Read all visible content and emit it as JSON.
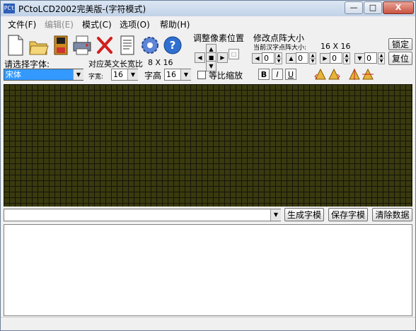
{
  "window": {
    "app_icon_text": "PCt",
    "title": "PCtoLCD2002完美版-(字符模式)",
    "controls": {
      "minimize": "—",
      "maximize": "□",
      "close": "X"
    }
  },
  "menu": [
    {
      "label": "文件(F)"
    },
    {
      "label": "编辑(E)"
    },
    {
      "label": "模式(C)"
    },
    {
      "label": "选项(O)"
    },
    {
      "label": "帮助(H)"
    }
  ],
  "toolbar": {
    "icons": [
      "new-icon",
      "open-icon",
      "save-icon",
      "print-icon",
      "delete-icon",
      "document-icon",
      "settings-gear-icon",
      "help-icon"
    ]
  },
  "font_panel": {
    "select_font_label": "请选择字体:",
    "font_value": "宋体",
    "english_width_label": "对应英文长宽比",
    "english_width_value": "8 X 16",
    "char_width_label": "字宽:",
    "char_width_value": "16",
    "char_height_label": "字高",
    "char_height_value": "16",
    "proportional_label": "等比缩放"
  },
  "pixel_panel": {
    "label": "调整像素位置"
  },
  "size_panel": {
    "label": "修改点阵大小",
    "current_size_label": "当前汉字点阵大小:",
    "current_size_value": "16 X 16",
    "lock_label": "锁定",
    "reset_label": "复位",
    "left_value": "0",
    "top_value": "0",
    "right_value": "0",
    "bottom_value": "0"
  },
  "format_buttons": {
    "bold": "B",
    "italic": "I",
    "underline": "U"
  },
  "bottom_bar": {
    "input_value": "",
    "generate_label": "生成字模",
    "save_label": "保存字模",
    "clear_label": "清除数据"
  },
  "output_text": "",
  "colors": {
    "grid_bg": "#3a3a0f",
    "grid_lines": "#15150a",
    "font_field_highlight": "#3399ff"
  }
}
